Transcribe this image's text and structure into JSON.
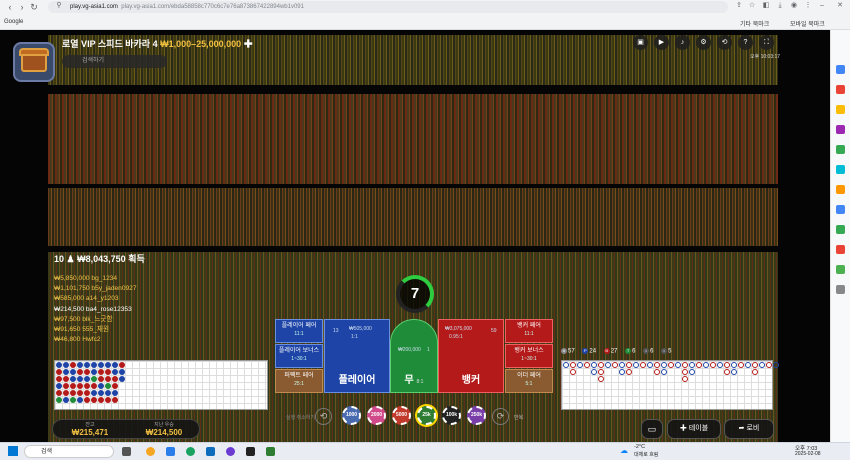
{
  "browser": {
    "url_host": "play.vg-asia1.com",
    "url_path": "play.vg-asia1.com/ebda58858c770c6c7e76a873867422894wb1v091",
    "bookmarks": [
      "Google",
      "기타 북마크",
      "모바일 북마크"
    ]
  },
  "game": {
    "title_prefix": "로열 VIP 스피드 바카라 4",
    "limits": "₩1,000–25,000,000",
    "search_placeholder": "검색하기",
    "clock": "오후 10:03:17",
    "winners_count": "10",
    "winners_total": "₩8,043,750",
    "winners_suffix": "획득",
    "winners": [
      {
        "amount": "₩5,850,000",
        "name": "bg_1234",
        "own": false
      },
      {
        "amount": "₩1,101,750",
        "name": "b5y_jaden0927",
        "own": false
      },
      {
        "amount": "₩585,000",
        "name": "a14_y1203",
        "own": false
      },
      {
        "amount": "₩214,500",
        "name": "ba4_rose12353",
        "own": true
      },
      {
        "amount": "₩97,500",
        "name": "blk_느긋함",
        "own": false
      },
      {
        "amount": "₩91,650",
        "name": "555_재원",
        "own": false
      },
      {
        "amount": "₩46,800",
        "name": "Hwfc2",
        "own": false
      }
    ],
    "timer": "7"
  },
  "bets": {
    "player_pair": {
      "label": "플레이어 페어",
      "ratio": "11:1"
    },
    "player_bonus": {
      "label": "플레이어 보너스",
      "ratio": "1~30:1"
    },
    "perfect_pair": {
      "label": "퍼펙트 페어",
      "ratio": "25:1"
    },
    "player": {
      "label": "플레이어",
      "ratio": "1:1",
      "amount": "₩505,000",
      "count": "13"
    },
    "tie": {
      "label": "무",
      "ratio": "8:1",
      "amount": "₩200,000",
      "count": "1"
    },
    "banker": {
      "label": "뱅커",
      "ratio": "0.95:1",
      "amount": "₩3,075,000",
      "count": "59"
    },
    "banker_pair": {
      "label": "뱅커 페어",
      "ratio": "11:1"
    },
    "banker_bonus": {
      "label": "뱅커 보너스",
      "ratio": "1~30:1"
    },
    "either_pair": {
      "label": "이더 페어",
      "ratio": "5:1"
    }
  },
  "stats": {
    "total": "57",
    "player": "24",
    "banker": "27",
    "tie": "6",
    "p_pair": "6",
    "b_pair": "5"
  },
  "chips": [
    {
      "label": "1000",
      "color": "#4a6ab0"
    },
    {
      "label": "2000",
      "color": "#d04a8a"
    },
    {
      "label": "5000",
      "color": "#c0392b"
    },
    {
      "label": "25k",
      "color": "#2e7d32"
    },
    {
      "label": "100k",
      "color": "#222222"
    },
    {
      "label": "250k",
      "color": "#7a3ea8"
    }
  ],
  "controls": {
    "undo_label": "실행 취소하기",
    "redo_label": "반복",
    "balance_label": "잔고",
    "balance": "₩215,471",
    "lastbet_label": "지난 우승",
    "lastbet": "₩214,500",
    "add_table": "테이블",
    "lobby": "로비"
  },
  "taskbar": {
    "search": "검색",
    "weather": "-2°C",
    "weather_sub": "대체로 흐림",
    "time": "오후 7:03",
    "date": "2025-02-08"
  },
  "colors": {
    "player": "#1d44a6",
    "banker": "#b51a1a",
    "tie": "#1e8c38",
    "gold": "#f0c040"
  }
}
